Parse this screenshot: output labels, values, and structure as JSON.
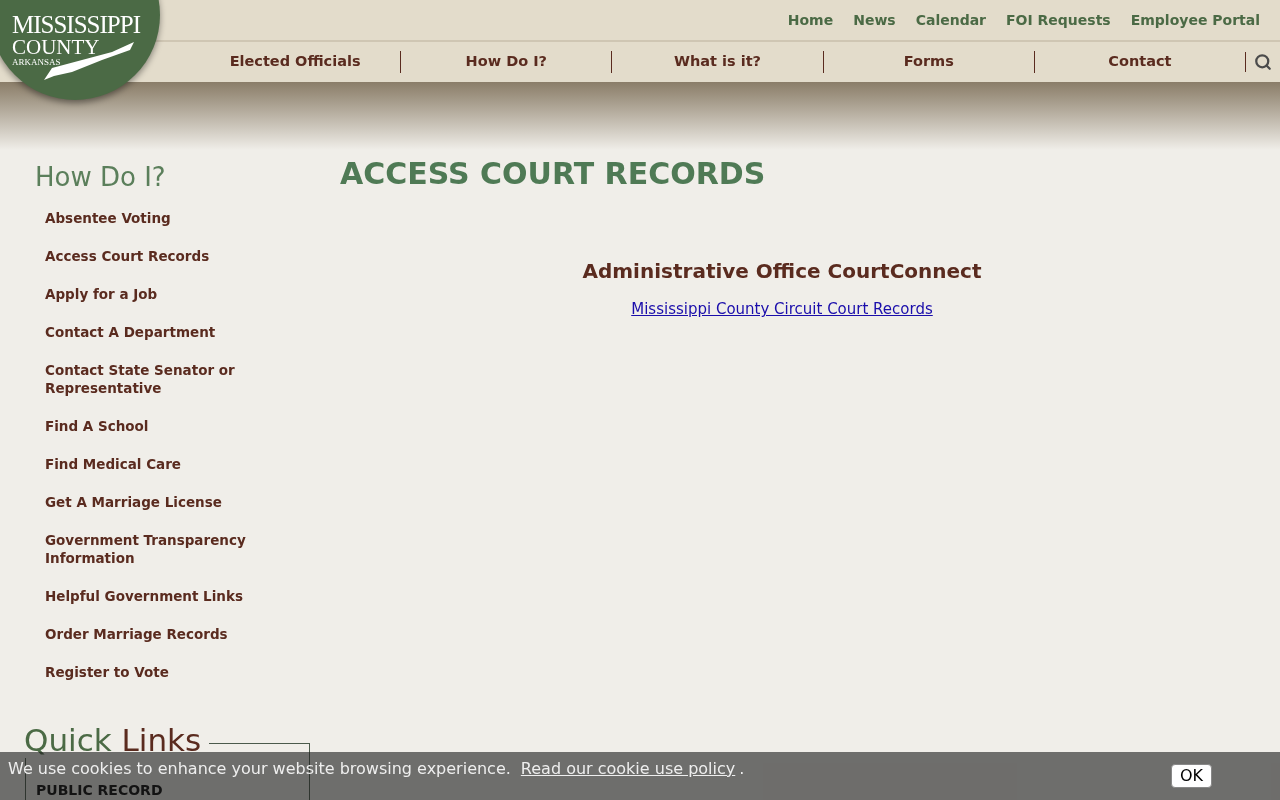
{
  "logo": {
    "lines": [
      "MISSISSIPPI",
      "COUNTY",
      "ARKANSAS"
    ]
  },
  "top_links": [
    "Home",
    "News",
    "Calendar",
    "FOI Requests",
    "Employee Portal"
  ],
  "nav": [
    "Elected Officials",
    "How Do I?",
    "What is it?",
    "Forms",
    "Contact"
  ],
  "sidebar": {
    "title": "How Do I?",
    "items": [
      {
        "label": "Absentee Voting"
      },
      {
        "label": "Access Court Records"
      },
      {
        "label": "Apply for a Job"
      },
      {
        "label": "Contact A Department"
      },
      {
        "label": "Contact State Senator or Representative"
      },
      {
        "label": "Find A School"
      },
      {
        "label": "Find Medical Care"
      },
      {
        "label": "Get A Marriage License"
      },
      {
        "label": "Government Transparency Information"
      },
      {
        "label": "Helpful Government Links"
      },
      {
        "label": "Order Marriage Records"
      },
      {
        "label": "Register to Vote"
      }
    ],
    "quick_links": {
      "title_parts": [
        "Quick",
        "Links"
      ],
      "items": [
        "PUBLIC RECORD"
      ]
    }
  },
  "page": {
    "title": "ACCESS COURT RECORDS",
    "heading": "Administrative Office CourtConnect",
    "link": "Mississippi County Circuit Court Records"
  },
  "cookie": {
    "text": "We use cookies to enhance your website browsing experience.",
    "link": "Read our cookie use policy",
    "after": ".",
    "button": "OK"
  }
}
